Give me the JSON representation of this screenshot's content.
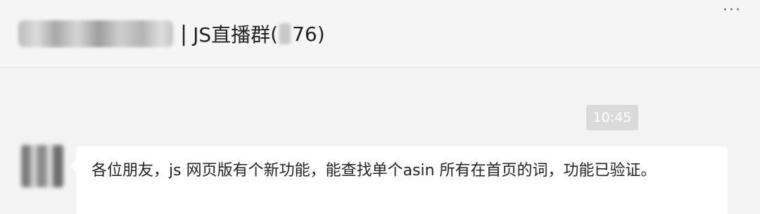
{
  "header": {
    "separator": "|",
    "group_name": "JS直播群",
    "open_paren": "(",
    "member_count_suffix": "76)",
    "more_icon": "more-dots-icon"
  },
  "chat": {
    "timestamp": "10:45",
    "messages": [
      {
        "text": "各位朋友，js 网页版有个新功能，能查找单个asin 所有在首页的词，功能已验证。"
      }
    ]
  }
}
